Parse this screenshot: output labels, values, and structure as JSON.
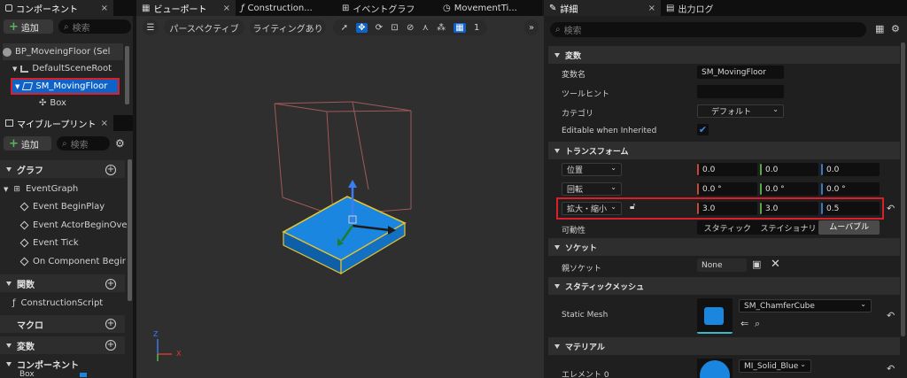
{
  "left_tab": {
    "title": "コンポーネント"
  },
  "components": {
    "add_label": "追加",
    "search_placeholder": "検索",
    "root": "BP_MoveingFloor (Sel",
    "scene_root": "DefaultSceneRoot",
    "selected": "SM_MovingFloor",
    "box": "Box"
  },
  "blueprint_tab": {
    "title": "マイブループリント"
  },
  "myblueprint": {
    "add_label": "追加",
    "search_placeholder": "検索",
    "graph_header": "グラフ",
    "event_graph": "EventGraph",
    "events": [
      "Event BeginPlay",
      "Event ActorBeginOve",
      "Event Tick",
      "On Component Begir"
    ],
    "functions_header": "関数",
    "construction_script": "ConstructionScript",
    "macros_header": "マクロ",
    "variables_header": "変数",
    "components_header": "コンポーネント",
    "component_item": "Box"
  },
  "center_tabs": [
    "ビューポート",
    "Construction...",
    "イベントグラフ",
    "MovementTi..."
  ],
  "viewport": {
    "perspective": "パースペクティブ",
    "lighting": "ライティングあり",
    "grid_num": "1",
    "axis_x": "X",
    "axis_z": "Z"
  },
  "right_tabs": {
    "details": "詳細",
    "output": "出力ログ"
  },
  "details": {
    "search_placeholder": "検索",
    "variable_section": "変数",
    "var_name_label": "変数名",
    "var_name_value": "SM_MovingFloor",
    "tooltip_label": "ツールヒント",
    "category_label": "カテゴリ",
    "category_value": "デフォルト",
    "editable_label": "Editable when Inherited",
    "transform_section": "トランスフォーム",
    "location_label": "位置",
    "location": [
      "0.0",
      "0.0",
      "0.0"
    ],
    "rotation_label": "回転",
    "rotation": [
      "0.0 °",
      "0.0 °",
      "0.0 °"
    ],
    "scale_label": "拡大・縮小",
    "scale": [
      "3.0",
      "3.0",
      "0.5"
    ],
    "mobility_label": "可動性",
    "mobility_options": [
      "スタティック",
      "ステイショナリ",
      "ムーバブル"
    ],
    "socket_section": "ソケット",
    "parent_socket_label": "親ソケット",
    "parent_socket_value": "None",
    "static_mesh_section": "スタティックメッシュ",
    "static_mesh_label": "Static Mesh",
    "static_mesh_value": "SM_ChamferCube",
    "material_section": "マテリアル",
    "element_label": "エレメント 0",
    "material_value": "MI_Solid_Blue"
  },
  "colors": {
    "accent_blue": "#0e63c9",
    "highlight_red": "#d9202a",
    "mesh_blue": "#1a86e0"
  }
}
